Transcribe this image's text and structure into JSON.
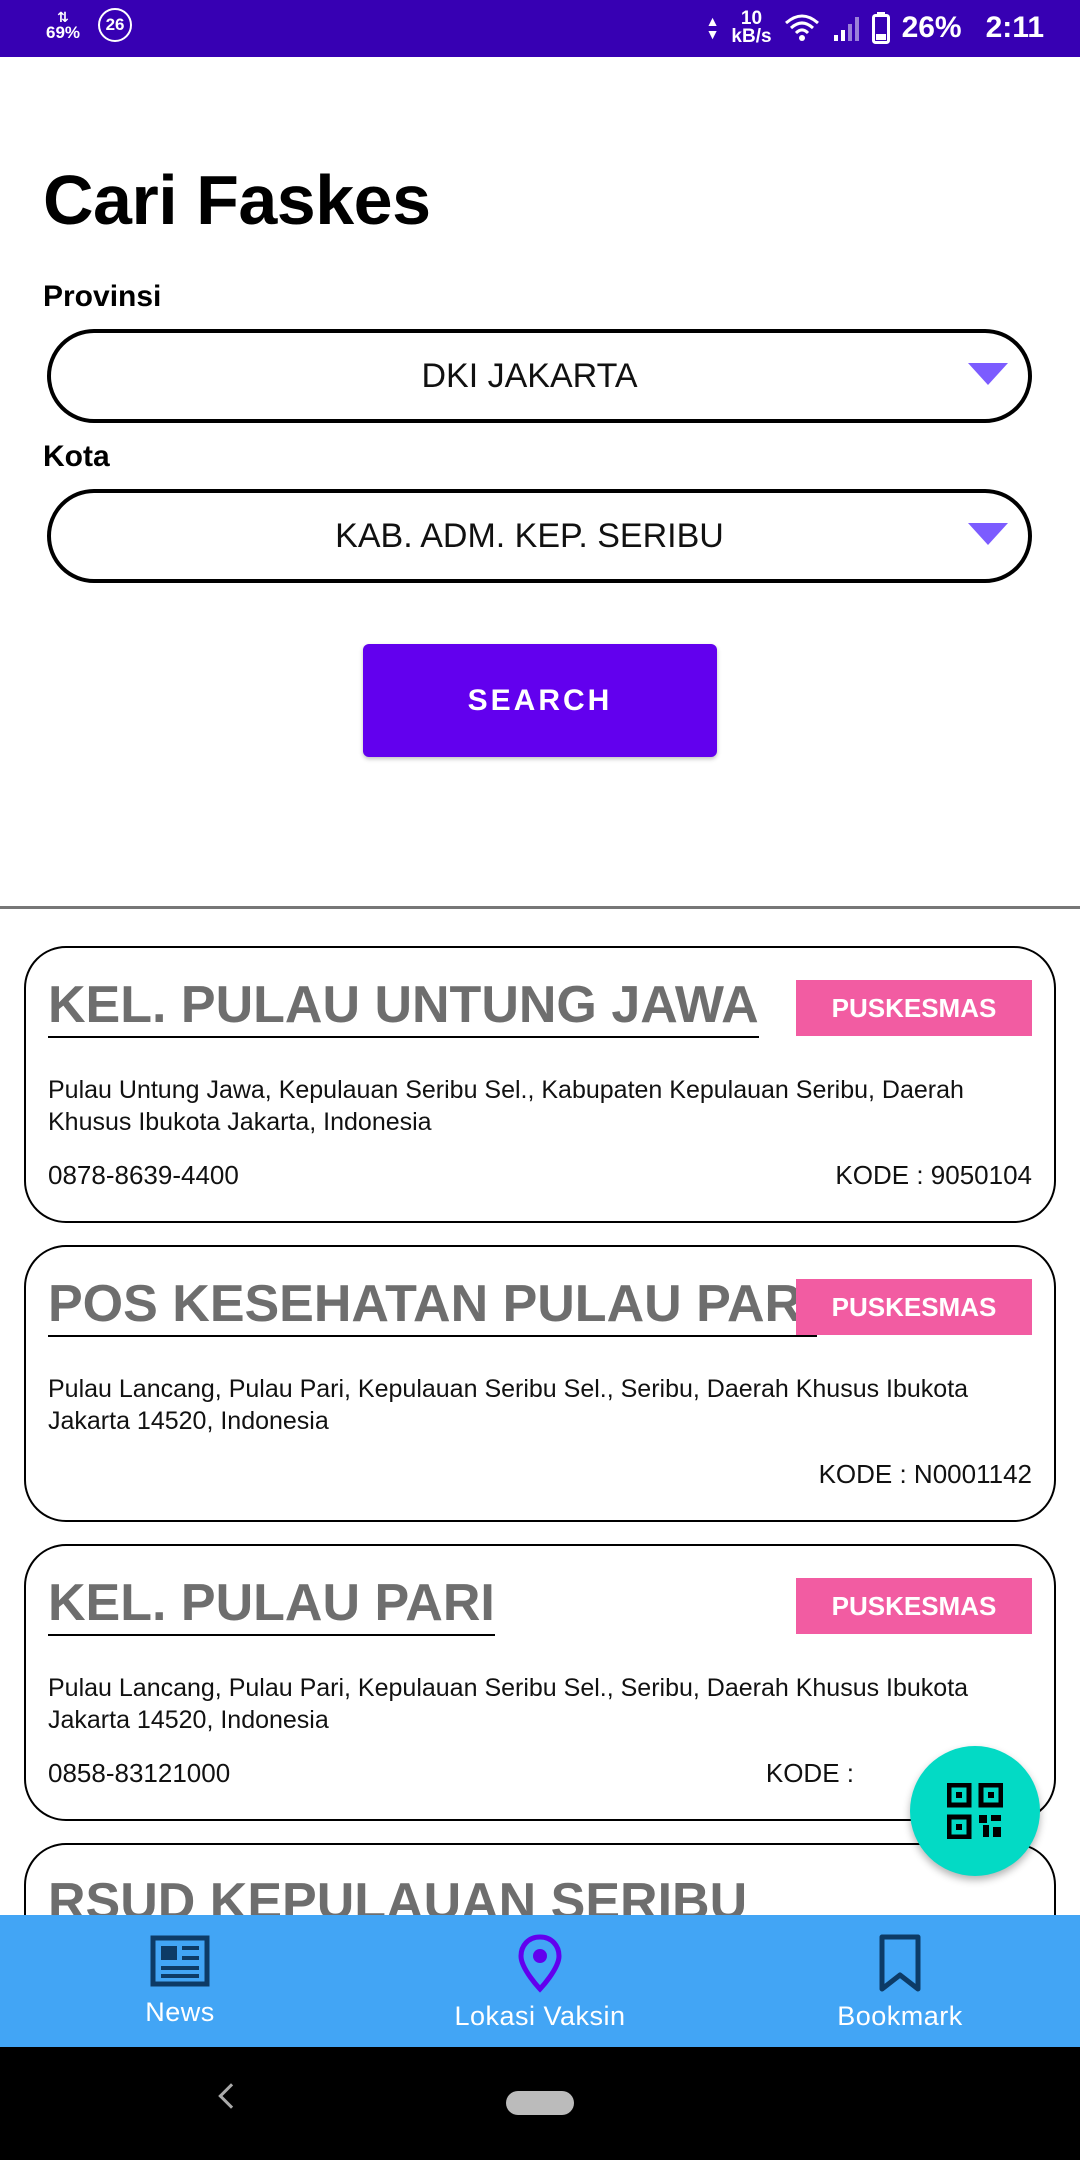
{
  "status_bar": {
    "data_usage": "69%",
    "notification_count": "26",
    "net_speed_value": "10",
    "net_speed_unit": "kB/s",
    "battery": "26%",
    "time": "2:11"
  },
  "page": {
    "title": "Cari Faskes",
    "province_label": "Provinsi",
    "province_value": "DKI JAKARTA",
    "city_label": "Kota",
    "city_value": "KAB. ADM. KEP. SERIBU",
    "search_label": "SEARCH"
  },
  "results": [
    {
      "name": "KEL. PULAU UNTUNG JAWA",
      "type": "PUSKESMAS",
      "address": "Pulau Untung Jawa, Kepulauan Seribu Sel., Kabupaten Kepulauan Seribu, Daerah Khusus Ibukota Jakarta, Indonesia",
      "phone": "0878-8639-4400",
      "code": "KODE : 9050104"
    },
    {
      "name": "POS KESEHATAN PULAU PARI",
      "type": "PUSKESMAS",
      "address": "Pulau Lancang, Pulau Pari, Kepulauan Seribu Sel., Seribu, Daerah Khusus Ibukota Jakarta 14520, Indonesia",
      "phone": "",
      "code": "KODE : N0001142"
    },
    {
      "name": "KEL. PULAU PARI",
      "type": "PUSKESMAS",
      "address": "Pulau Lancang, Pulau Pari, Kepulauan Seribu Sel., Seribu, Daerah Khusus Ibukota Jakarta 14520, Indonesia",
      "phone": "0858-83121000",
      "code": "KODE :"
    },
    {
      "name": "RSUD KEPULAUAN SERIBU",
      "type": "",
      "address": "",
      "phone": "",
      "code": ""
    }
  ],
  "fab": {
    "icon": "qr-code-icon"
  },
  "bottom_nav": {
    "items": [
      {
        "label": "News",
        "icon": "news-icon"
      },
      {
        "label": "Lokasi Vaksin",
        "icon": "location-pin-icon"
      },
      {
        "label": "Bookmark",
        "icon": "bookmark-icon"
      }
    ]
  },
  "colors": {
    "status_bar": "#3700b3",
    "primary": "#6200ee",
    "badge": "#f25ca2",
    "fab": "#03dac5",
    "bottom_nav": "#42a5f5"
  }
}
